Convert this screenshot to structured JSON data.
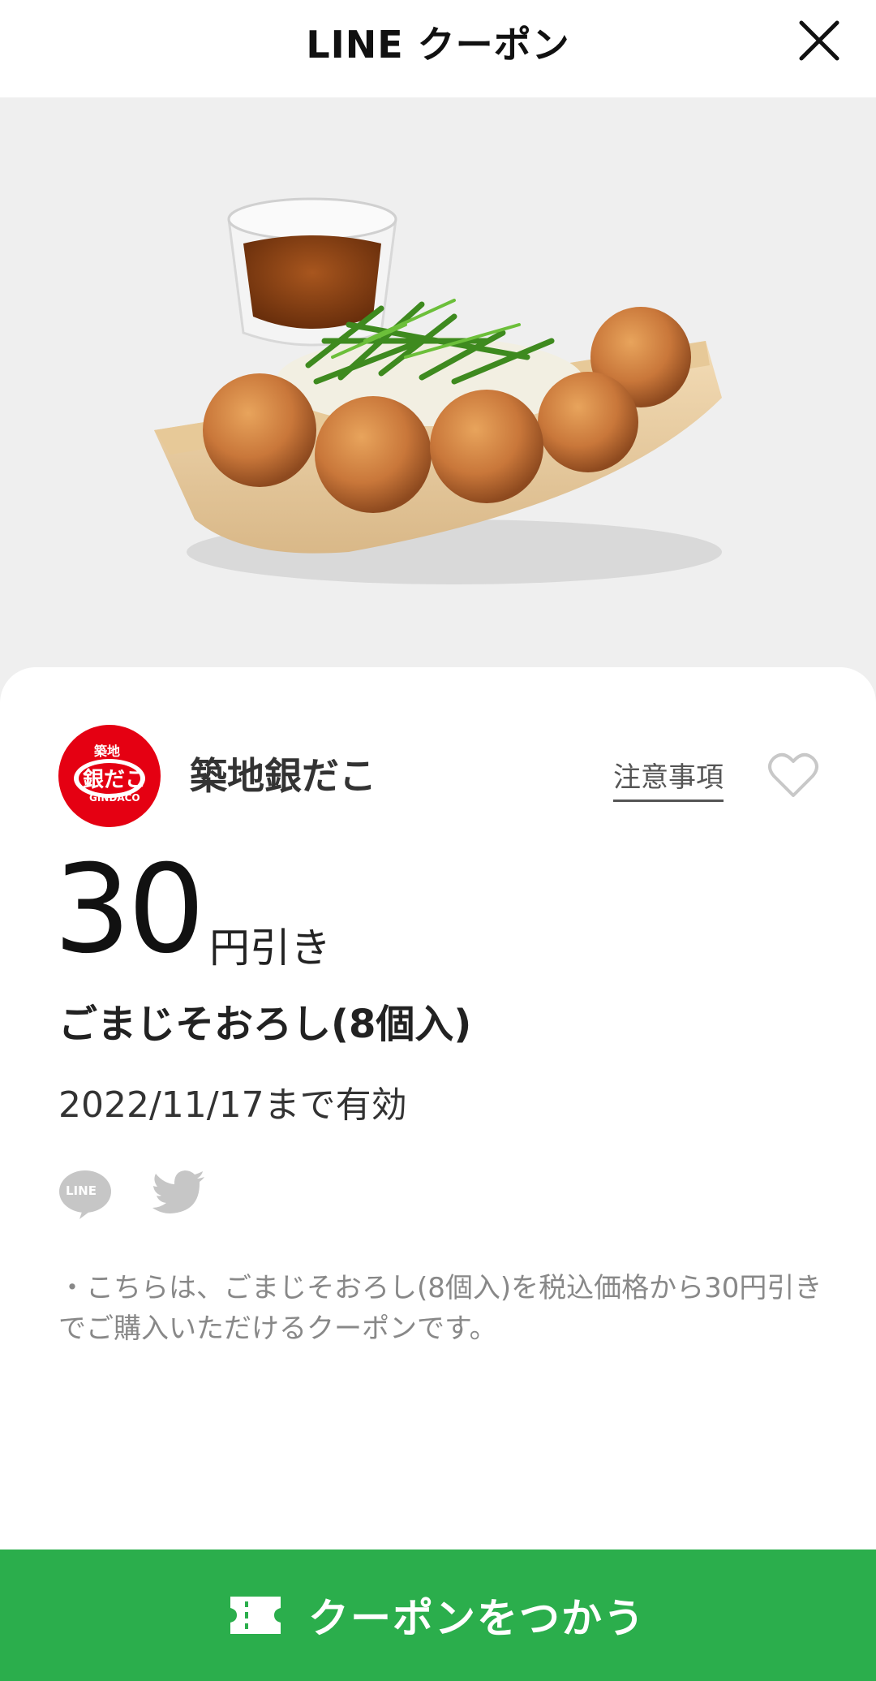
{
  "header": {
    "title": "LINE クーポン"
  },
  "store": {
    "name": "築地銀だこ",
    "logo_text_top": "築地",
    "logo_text_main": "銀だこ",
    "logo_text_sub": "GINDACO",
    "logo_color": "#e50012"
  },
  "coupon": {
    "notice_label": "注意事項",
    "amount": "30",
    "amount_unit": "円引き",
    "product_name": "ごまじそおろし(8個入)",
    "validity": "2022/11/17まで有効",
    "description": "・こちらは、ごまじそおろし(8個入)を税込価格から30円引きでご購入いただけるクーポンです。"
  },
  "share": {
    "line_label": "LINE"
  },
  "action": {
    "use_label": "クーポンをつかう",
    "button_color": "#2bae4c"
  }
}
